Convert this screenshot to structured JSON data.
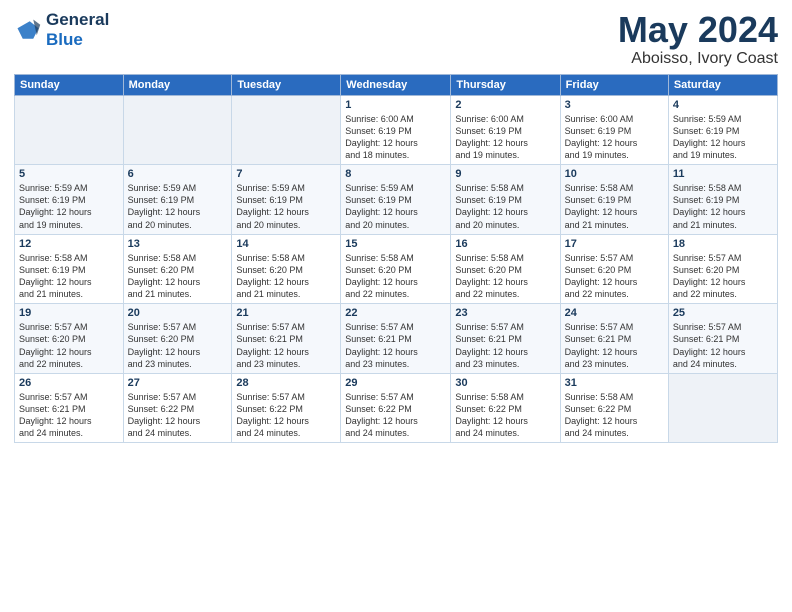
{
  "logo": {
    "line1": "General",
    "line2": "Blue"
  },
  "header": {
    "title": "May 2024",
    "subtitle": "Aboisso, Ivory Coast"
  },
  "weekdays": [
    "Sunday",
    "Monday",
    "Tuesday",
    "Wednesday",
    "Thursday",
    "Friday",
    "Saturday"
  ],
  "weeks": [
    [
      {
        "day": "",
        "info": ""
      },
      {
        "day": "",
        "info": ""
      },
      {
        "day": "",
        "info": ""
      },
      {
        "day": "1",
        "info": "Sunrise: 6:00 AM\nSunset: 6:19 PM\nDaylight: 12 hours\nand 18 minutes."
      },
      {
        "day": "2",
        "info": "Sunrise: 6:00 AM\nSunset: 6:19 PM\nDaylight: 12 hours\nand 19 minutes."
      },
      {
        "day": "3",
        "info": "Sunrise: 6:00 AM\nSunset: 6:19 PM\nDaylight: 12 hours\nand 19 minutes."
      },
      {
        "day": "4",
        "info": "Sunrise: 5:59 AM\nSunset: 6:19 PM\nDaylight: 12 hours\nand 19 minutes."
      }
    ],
    [
      {
        "day": "5",
        "info": "Sunrise: 5:59 AM\nSunset: 6:19 PM\nDaylight: 12 hours\nand 19 minutes."
      },
      {
        "day": "6",
        "info": "Sunrise: 5:59 AM\nSunset: 6:19 PM\nDaylight: 12 hours\nand 20 minutes."
      },
      {
        "day": "7",
        "info": "Sunrise: 5:59 AM\nSunset: 6:19 PM\nDaylight: 12 hours\nand 20 minutes."
      },
      {
        "day": "8",
        "info": "Sunrise: 5:59 AM\nSunset: 6:19 PM\nDaylight: 12 hours\nand 20 minutes."
      },
      {
        "day": "9",
        "info": "Sunrise: 5:58 AM\nSunset: 6:19 PM\nDaylight: 12 hours\nand 20 minutes."
      },
      {
        "day": "10",
        "info": "Sunrise: 5:58 AM\nSunset: 6:19 PM\nDaylight: 12 hours\nand 21 minutes."
      },
      {
        "day": "11",
        "info": "Sunrise: 5:58 AM\nSunset: 6:19 PM\nDaylight: 12 hours\nand 21 minutes."
      }
    ],
    [
      {
        "day": "12",
        "info": "Sunrise: 5:58 AM\nSunset: 6:19 PM\nDaylight: 12 hours\nand 21 minutes."
      },
      {
        "day": "13",
        "info": "Sunrise: 5:58 AM\nSunset: 6:20 PM\nDaylight: 12 hours\nand 21 minutes."
      },
      {
        "day": "14",
        "info": "Sunrise: 5:58 AM\nSunset: 6:20 PM\nDaylight: 12 hours\nand 21 minutes."
      },
      {
        "day": "15",
        "info": "Sunrise: 5:58 AM\nSunset: 6:20 PM\nDaylight: 12 hours\nand 22 minutes."
      },
      {
        "day": "16",
        "info": "Sunrise: 5:58 AM\nSunset: 6:20 PM\nDaylight: 12 hours\nand 22 minutes."
      },
      {
        "day": "17",
        "info": "Sunrise: 5:57 AM\nSunset: 6:20 PM\nDaylight: 12 hours\nand 22 minutes."
      },
      {
        "day": "18",
        "info": "Sunrise: 5:57 AM\nSunset: 6:20 PM\nDaylight: 12 hours\nand 22 minutes."
      }
    ],
    [
      {
        "day": "19",
        "info": "Sunrise: 5:57 AM\nSunset: 6:20 PM\nDaylight: 12 hours\nand 22 minutes."
      },
      {
        "day": "20",
        "info": "Sunrise: 5:57 AM\nSunset: 6:20 PM\nDaylight: 12 hours\nand 23 minutes."
      },
      {
        "day": "21",
        "info": "Sunrise: 5:57 AM\nSunset: 6:21 PM\nDaylight: 12 hours\nand 23 minutes."
      },
      {
        "day": "22",
        "info": "Sunrise: 5:57 AM\nSunset: 6:21 PM\nDaylight: 12 hours\nand 23 minutes."
      },
      {
        "day": "23",
        "info": "Sunrise: 5:57 AM\nSunset: 6:21 PM\nDaylight: 12 hours\nand 23 minutes."
      },
      {
        "day": "24",
        "info": "Sunrise: 5:57 AM\nSunset: 6:21 PM\nDaylight: 12 hours\nand 23 minutes."
      },
      {
        "day": "25",
        "info": "Sunrise: 5:57 AM\nSunset: 6:21 PM\nDaylight: 12 hours\nand 24 minutes."
      }
    ],
    [
      {
        "day": "26",
        "info": "Sunrise: 5:57 AM\nSunset: 6:21 PM\nDaylight: 12 hours\nand 24 minutes."
      },
      {
        "day": "27",
        "info": "Sunrise: 5:57 AM\nSunset: 6:22 PM\nDaylight: 12 hours\nand 24 minutes."
      },
      {
        "day": "28",
        "info": "Sunrise: 5:57 AM\nSunset: 6:22 PM\nDaylight: 12 hours\nand 24 minutes."
      },
      {
        "day": "29",
        "info": "Sunrise: 5:57 AM\nSunset: 6:22 PM\nDaylight: 12 hours\nand 24 minutes."
      },
      {
        "day": "30",
        "info": "Sunrise: 5:58 AM\nSunset: 6:22 PM\nDaylight: 12 hours\nand 24 minutes."
      },
      {
        "day": "31",
        "info": "Sunrise: 5:58 AM\nSunset: 6:22 PM\nDaylight: 12 hours\nand 24 minutes."
      },
      {
        "day": "",
        "info": ""
      }
    ]
  ]
}
